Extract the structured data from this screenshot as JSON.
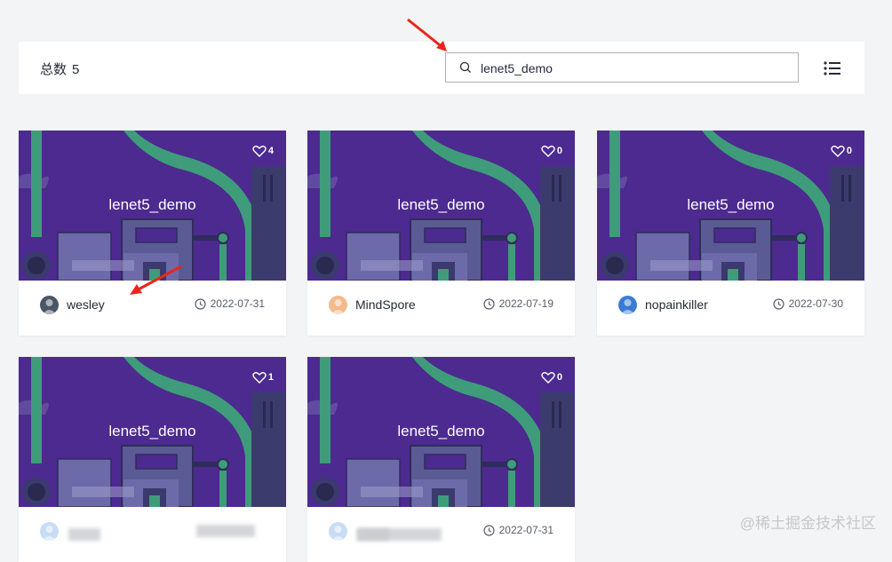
{
  "header": {
    "total_label": "总数",
    "total_count": "5",
    "search_value": "lenet5_demo",
    "search_icon": "search-icon",
    "view_toggle_icon": "list-icon"
  },
  "cards": [
    {
      "title": "lenet5_demo",
      "likes": "4",
      "author": "wesley",
      "date": "2022-07-31",
      "avatar_color": "#4a5568"
    },
    {
      "title": "lenet5_demo",
      "likes": "0",
      "author": "MindSpore",
      "date": "2022-07-19",
      "avatar_color": "#f6b98a"
    },
    {
      "title": "lenet5_demo",
      "likes": "0",
      "author": "nopainkiller",
      "date": "2022-07-30",
      "avatar_color": "#3a7bd5"
    },
    {
      "title": "lenet5_demo",
      "likes": "1",
      "author": "",
      "date": "",
      "avatar_color": "#c7ddf5"
    },
    {
      "title": "lenet5_demo",
      "likes": "0",
      "author": "",
      "date": "2022-07-31",
      "avatar_color": "#c7ddf5"
    }
  ],
  "colors": {
    "accent_arrow": "#e8261b",
    "thumb_bg": "#4a2a8e",
    "pipe": "#3f9c7a"
  },
  "watermark": "@稀土掘金技术社区"
}
